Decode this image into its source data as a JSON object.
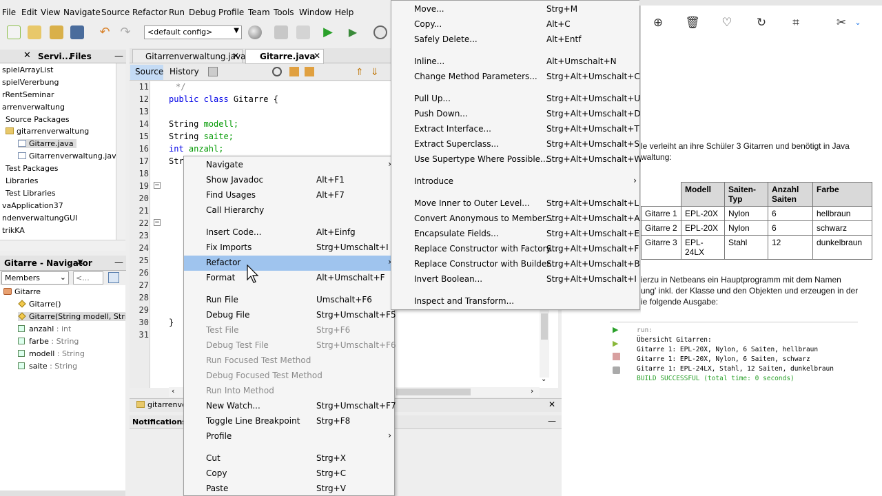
{
  "menubar": [
    "File",
    "Edit",
    "View",
    "Navigate",
    "Source",
    "Refactor",
    "Run",
    "Debug",
    "Profile",
    "Team",
    "Tools",
    "Window",
    "Help"
  ],
  "toolbar": {
    "config": "<default config>"
  },
  "projects_panel": {
    "tabs": [
      "Servi...",
      "Files"
    ],
    "items": [
      "spielArrayList",
      "spielVererbung",
      "rRentSeminar",
      "arrenverwaltung",
      "Source Packages",
      "gitarrenverwaltung",
      "Gitarre.java",
      "Gitarrenverwaltung.java",
      "Test Packages",
      "Libraries",
      "Test Libraries",
      "vaApplication37",
      "ndenverwaltungGUI",
      "trikKA"
    ]
  },
  "navigator": {
    "title": "Gitarre - Navigator",
    "filter": "Members",
    "filter2": "<...",
    "root": "Gitarre",
    "members": [
      {
        "name": "Gitarre()",
        "type": ""
      },
      {
        "name": "Gitarre(String modell, String",
        "type": ""
      },
      {
        "name": "anzahl",
        "type": " : int"
      },
      {
        "name": "farbe",
        "type": " : String"
      },
      {
        "name": "modell",
        "type": " : String"
      },
      {
        "name": "saite",
        "type": " : String"
      }
    ]
  },
  "editor": {
    "tabs": [
      "Gitarrenverwaltung.java",
      "Gitarre.java"
    ],
    "source_tab": "Source",
    "history_tab": "History",
    "line_numbers": [
      "11",
      "12",
      "13",
      "14",
      "15",
      "16",
      "17",
      "18",
      "19",
      "20",
      "21",
      "22",
      "23",
      "24",
      "25",
      "26",
      "27",
      "28",
      "29",
      "30",
      "31"
    ],
    "lines": {
      "l11": "*/",
      "l12a": "public class",
      "l12b": " Gitarre {",
      "l14a": "String",
      "l14b": " modell;",
      "l15a": "String",
      "l15b": " saite;",
      "l16a": "int",
      "l16b": " anzahl;",
      "l17": "Str",
      "l30": "}"
    },
    "bottom_tab": "gitarrenve",
    "notifications": "Notifications"
  },
  "context_menu": {
    "items": [
      {
        "label": "Navigate",
        "shortcut": "",
        "submenu": true
      },
      {
        "label": "Show Javadoc",
        "shortcut": "Alt+F1"
      },
      {
        "label": "Find Usages",
        "shortcut": "Alt+F7"
      },
      {
        "label": "Call Hierarchy",
        "shortcut": ""
      },
      {
        "label": "Insert Code...",
        "shortcut": "Alt+Einfg"
      },
      {
        "label": "Fix Imports",
        "shortcut": "Strg+Umschalt+I"
      },
      {
        "label": "Refactor",
        "shortcut": "",
        "submenu": true,
        "highlight": true
      },
      {
        "label": "Format",
        "shortcut": "Alt+Umschalt+F"
      },
      {
        "label": "Run File",
        "shortcut": "Umschalt+F6"
      },
      {
        "label": "Debug File",
        "shortcut": "Strg+Umschalt+F5"
      },
      {
        "label": "Test File",
        "shortcut": "Strg+F6",
        "disabled": true
      },
      {
        "label": "Debug Test File",
        "shortcut": "Strg+Umschalt+F6",
        "disabled": true
      },
      {
        "label": "Run Focused Test Method",
        "shortcut": "",
        "disabled": true
      },
      {
        "label": "Debug Focused Test Method",
        "shortcut": "",
        "disabled": true
      },
      {
        "label": "Run Into Method",
        "shortcut": "",
        "disabled": true
      },
      {
        "label": "New Watch...",
        "shortcut": "Strg+Umschalt+F7"
      },
      {
        "label": "Toggle Line Breakpoint",
        "shortcut": "Strg+F8"
      },
      {
        "label": "Profile",
        "shortcut": "",
        "submenu": true
      },
      {
        "label": "Cut",
        "shortcut": "Strg+X"
      },
      {
        "label": "Copy",
        "shortcut": "Strg+C"
      },
      {
        "label": "Paste",
        "shortcut": "Strg+V"
      }
    ]
  },
  "refactor_menu": {
    "items": [
      {
        "label": "Move...",
        "shortcut": "Strg+M"
      },
      {
        "label": "Copy...",
        "shortcut": "Alt+C"
      },
      {
        "label": "Safely Delete...",
        "shortcut": "Alt+Entf"
      },
      {
        "label": "Inline...",
        "shortcut": "Alt+Umschalt+N"
      },
      {
        "label": "Change Method Parameters...",
        "shortcut": "Strg+Alt+Umschalt+C"
      },
      {
        "label": "Pull Up...",
        "shortcut": "Strg+Alt+Umschalt+U"
      },
      {
        "label": "Push Down...",
        "shortcut": "Strg+Alt+Umschalt+D"
      },
      {
        "label": "Extract Interface...",
        "shortcut": "Strg+Alt+Umschalt+T"
      },
      {
        "label": "Extract Superclass...",
        "shortcut": "Strg+Alt+Umschalt+S"
      },
      {
        "label": "Use Supertype Where Possible...",
        "shortcut": "Strg+Alt+Umschalt+W"
      },
      {
        "label": "Introduce",
        "shortcut": "",
        "submenu": true
      },
      {
        "label": "Move Inner to Outer Level...",
        "shortcut": "Strg+Alt+Umschalt+L"
      },
      {
        "label": "Convert Anonymous to Member...",
        "shortcut": "Strg+Alt+Umschalt+A"
      },
      {
        "label": "Encapsulate Fields...",
        "shortcut": "Strg+Alt+Umschalt+E"
      },
      {
        "label": "Replace Constructor with Factory...",
        "shortcut": "Strg+Alt+Umschalt+F"
      },
      {
        "label": "Replace Constructor with Builder...",
        "shortcut": "Strg+Alt+Umschalt+B"
      },
      {
        "label": "Invert Boolean...",
        "shortcut": "Strg+Alt+Umschalt+I"
      },
      {
        "label": "Inspect and Transform...",
        "shortcut": ""
      }
    ]
  },
  "document": {
    "para1_line1": "le verleiht an ihre Schüler 3 Gitarren und benötigt in Java",
    "para1_line2": "waltung:",
    "table": {
      "headers": [
        "",
        "Modell",
        "Saiten-Typ",
        "Anzahl Saiten",
        "Farbe"
      ],
      "rows": [
        [
          "Gitarre 1",
          "EPL-20X",
          "Nylon",
          "6",
          "hellbraun"
        ],
        [
          "Gitarre 2",
          "EPL-20X",
          "Nylon",
          "6",
          "schwarz"
        ],
        [
          "Gitarre 3",
          "EPL-24LX",
          "Stahl",
          "12",
          "dunkelbraun"
        ]
      ]
    },
    "para2_line1": "ierzu in Netbeans ein Hauptprogramm mit dem Namen",
    "para2_line2": "ung' inkl. der Klasse und den Objekten und erzeugen in der",
    "para2_line3": "ie folgende Ausgabe:",
    "console": {
      "run": "run:",
      "l1": "Übersicht Gitarren:",
      "l2": "Gitarre 1: EPL-20X, Nylon, 6 Saiten, hellbraun",
      "l3": "Gitarre 1: EPL-20X, Nylon, 6 Saiten, schwarz",
      "l4": "Gitarre 1: EPL-24LX, Stahl, 12 Saiten, dunkelbraun",
      "build": "BUILD SUCCESSFUL (total time: 0 seconds)"
    }
  }
}
